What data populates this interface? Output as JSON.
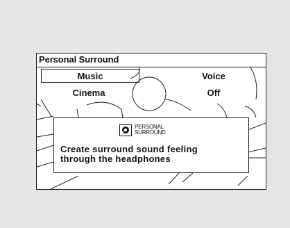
{
  "window": {
    "title": "Personal Surround"
  },
  "menu": {
    "items": [
      {
        "label": "Music",
        "selected": true
      },
      {
        "label": "Voice",
        "selected": false
      },
      {
        "label": "Cinema",
        "selected": false
      },
      {
        "label": "Off",
        "selected": false
      }
    ]
  },
  "info": {
    "logo_text_line1": "PERSONAL",
    "logo_text_line2": "SURROUND",
    "logo_icon": "personal-surround-logo-icon",
    "message": "Create surround sound feeling\nthrough the headphones"
  }
}
